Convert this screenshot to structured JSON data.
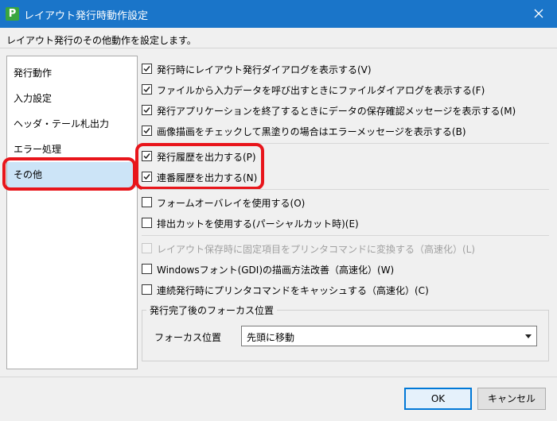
{
  "window": {
    "title": "レイアウト発行時動作設定",
    "app_icon_letter": "P",
    "description": "レイアウト発行のその他動作を設定します。"
  },
  "sidebar": {
    "items": [
      {
        "label": "発行動作"
      },
      {
        "label": "入力設定"
      },
      {
        "label": "ヘッダ・テール札出力"
      },
      {
        "label": "エラー処理"
      },
      {
        "label": "その他",
        "selected": true
      }
    ]
  },
  "options": {
    "group1": [
      {
        "label": "発行時にレイアウト発行ダイアログを表示する(V)",
        "checked": true
      },
      {
        "label": "ファイルから入力データを呼び出すときにファイルダイアログを表示する(F)",
        "checked": true
      },
      {
        "label": "発行アプリケーションを終了するときにデータの保存確認メッセージを表示する(M)",
        "checked": true
      },
      {
        "label": "画像描画をチェックして黒塗りの場合はエラーメッセージを表示する(B)",
        "checked": true
      }
    ],
    "group2": [
      {
        "label": "発行履歴を出力する(P)",
        "checked": true
      },
      {
        "label": "連番履歴を出力する(N)",
        "checked": true
      }
    ],
    "group3": [
      {
        "label": "フォームオーバレイを使用する(O)",
        "checked": false
      },
      {
        "label": "排出カットを使用する(パーシャルカット時)(E)",
        "checked": false
      }
    ],
    "group4": [
      {
        "label": "レイアウト保存時に固定項目をプリンタコマンドに変換する（高速化）(L)",
        "checked": false,
        "disabled": true
      },
      {
        "label": "Windowsフォント(GDI)の描画方法改善（高速化）(W)",
        "checked": false
      },
      {
        "label": "連続発行時にプリンタコマンドをキャッシュする（高速化）(C)",
        "checked": false
      }
    ]
  },
  "focus": {
    "group_title": "発行完了後のフォーカス位置",
    "label": "フォーカス位置",
    "value": "先頭に移動"
  },
  "buttons": {
    "ok": "OK",
    "cancel": "キャンセル"
  },
  "colors": {
    "titlebar": "#1a75c9",
    "highlight": "#e8151b",
    "selected_nav": "#cce4f7",
    "default_button": "#0078d7"
  }
}
